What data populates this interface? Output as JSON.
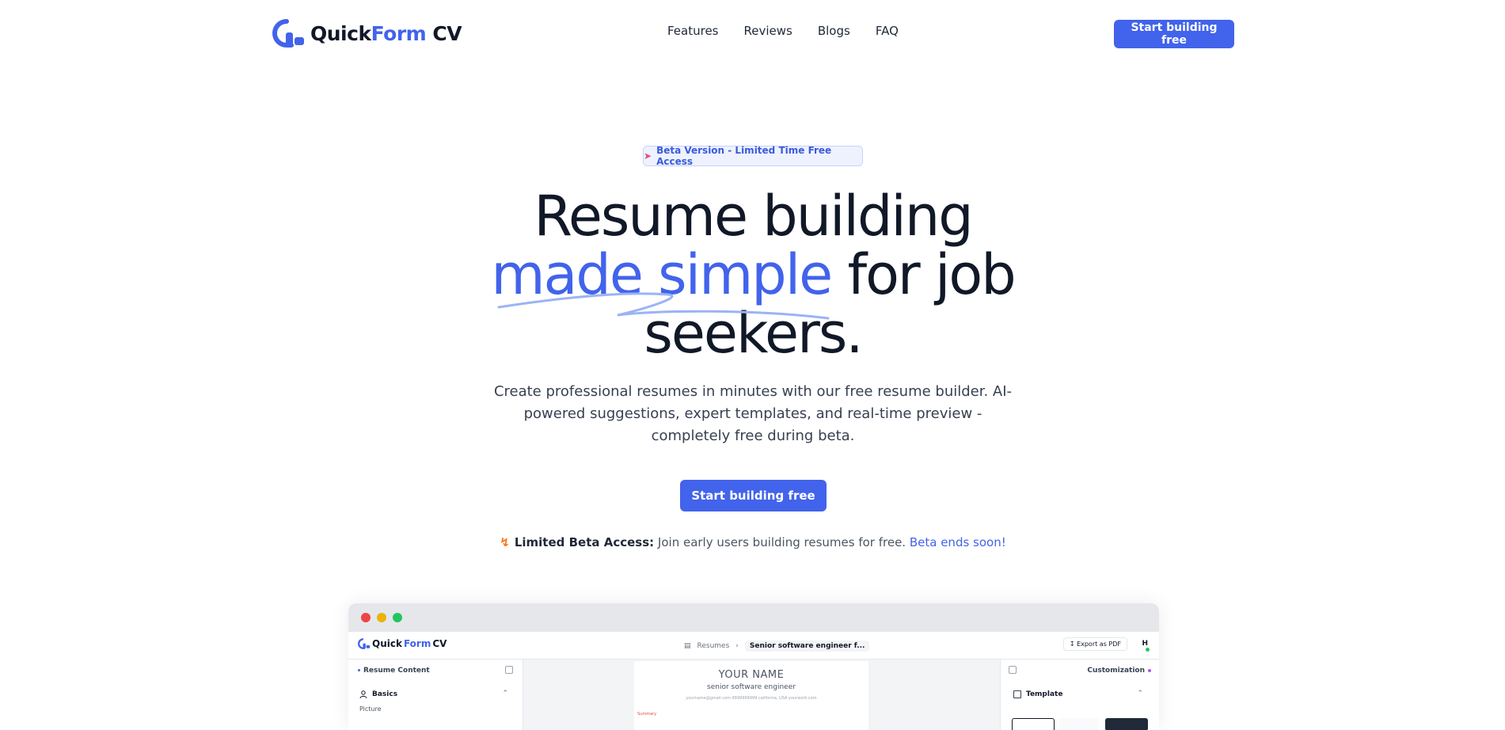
{
  "nav": {
    "logo_primary": "Quick",
    "logo_accent": "Form",
    "logo_suffix": " CV",
    "links": [
      "Features",
      "Reviews",
      "Blogs",
      "FAQ"
    ],
    "cta_label": "Start building free"
  },
  "hero": {
    "badge": "Beta Version - Limited Time Free Access",
    "headline_line1": "Resume building",
    "headline_highlight": "made simple",
    "headline_rest": " for job",
    "headline_line3": "seekers.",
    "subtext": "Create professional resumes in minutes with our free resume builder. AI-powered suggestions, expert templates, and real-time preview - completely free during beta.",
    "cta_label": "Start building free",
    "note_label": "Limited Beta Access:",
    "note_text": " Join early users building resumes for free. ",
    "note_link": "Beta ends soon!"
  },
  "preview": {
    "app_logo_primary": "Quick",
    "app_logo_accent": "Form",
    "app_logo_suffix": " CV",
    "breadcrumb_root": "Resumes",
    "breadcrumb_current": "Senior software engineer f...",
    "export_label": "Export as PDF",
    "avatar_initial": "H",
    "left_title": "Resume Content",
    "basics_label": "Basics",
    "picture_label": "Picture",
    "resume_name": "YOUR NAME",
    "resume_title": "senior software engineer",
    "resume_contact": "yourname@gmail.com   9999999999   california, USA   yourwork.com",
    "resume_summary": "Summary",
    "right_title": "Customization",
    "template_label": "Template"
  },
  "colors": {
    "accent": "#4263eb",
    "text": "#111827",
    "dot_red": "#ef4444",
    "dot_yellow": "#eab308",
    "dot_green": "#22c55e"
  }
}
